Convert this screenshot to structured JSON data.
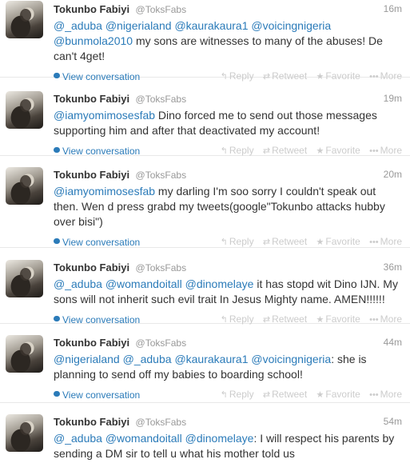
{
  "tweets": [
    {
      "name": "Tokunbo Fabiyi",
      "handle": "@ToksFabs",
      "time": "16m",
      "mentions_line1": [
        "@_aduba",
        "@nigerialand",
        "@kaurakaura1",
        "@voicingnigeria"
      ],
      "mention_line2": "@bunmola2010",
      "text_rest": " my sons are witnesses to many of the abuses! De can't 4get!",
      "view_conversation": "View conversation"
    },
    {
      "name": "Tokunbo Fabiyi",
      "handle": "@ToksFabs",
      "time": "19m",
      "mention": "@iamyomimosesfab",
      "text_rest": " Dino forced me to send out those messages supporting him and after that deactivated my account!",
      "view_conversation": "View conversation"
    },
    {
      "name": "Tokunbo Fabiyi",
      "handle": "@ToksFabs",
      "time": "20m",
      "mention": "@iamyomimosesfab",
      "text_rest": " my darling I'm soo sorry I couldn't speak out then. Wen d press grabd my tweets(google\"Tokunbo attacks hubby over bisi\")",
      "view_conversation": "View conversation"
    },
    {
      "name": "Tokunbo Fabiyi",
      "handle": "@ToksFabs",
      "time": "36m",
      "mentions": [
        "@_aduba",
        "@womandoitall",
        "@dinomelaye"
      ],
      "text_rest": " it has stopd wit Dino IJN. My sons will not inherit such evil trait In Jesus Mighty name. AMEN!!!!!!",
      "view_conversation": "View conversation"
    },
    {
      "name": "Tokunbo Fabiyi",
      "handle": "@ToksFabs",
      "time": "44m",
      "mentions": [
        "@nigerialand",
        "@_aduba",
        "@kaurakaura1",
        "@voicingnigeria"
      ],
      "text_rest": ": she is planning to send off my babies to boarding school!",
      "view_conversation": "View conversation"
    },
    {
      "name": "Tokunbo Fabiyi",
      "handle": "@ToksFabs",
      "time": "54m",
      "mentions": [
        "@_aduba",
        "@womandoitall",
        "@dinomelaye"
      ],
      "text_rest": ": I will respect his parents by sending a DM sir to tell u what his mother told us",
      "view_conversation": ""
    }
  ],
  "actions": {
    "reply": "Reply",
    "retweet": "Retweet",
    "favorite": "Favorite",
    "more": "More"
  },
  "icons": {
    "reply": "reply-arrow-icon",
    "retweet": "retweet-icon",
    "favorite": "star-icon",
    "more": "ellipsis-icon",
    "conversation": "speech-bubble-icon"
  },
  "colors": {
    "mention": "#2b7bb9",
    "muted": "#999999",
    "action": "#cccccc"
  }
}
